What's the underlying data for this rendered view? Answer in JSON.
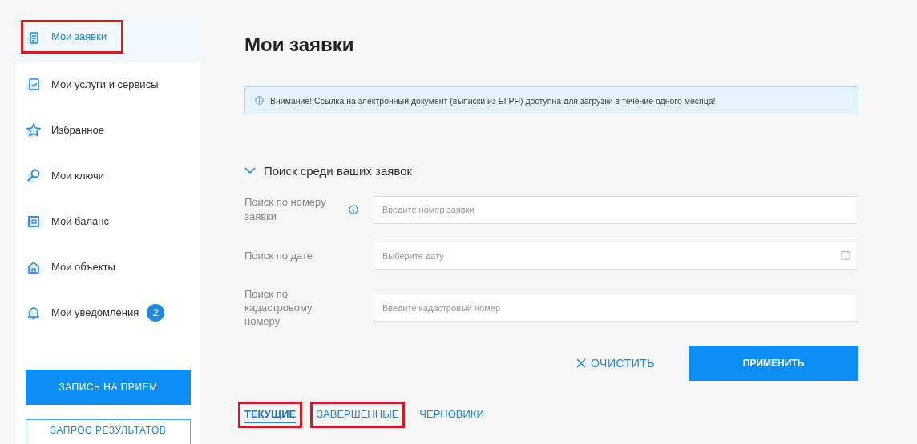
{
  "sidebar": {
    "items": [
      {
        "label": "Мои заявки",
        "kind": "document",
        "selected": true,
        "highlighted": true
      },
      {
        "label": "Мои услуги и сервисы",
        "kind": "checklist",
        "selected": false,
        "highlighted": false
      },
      {
        "label": "Избранное",
        "kind": "star",
        "selected": false,
        "highlighted": false
      },
      {
        "label": "Мои ключи",
        "kind": "key",
        "selected": false,
        "highlighted": false
      },
      {
        "label": "Мой баланс",
        "kind": "wallet",
        "selected": false,
        "highlighted": false
      },
      {
        "label": "Мои объекты",
        "kind": "house",
        "selected": false,
        "highlighted": false
      },
      {
        "label": "Мои уведомления",
        "kind": "bell",
        "selected": false,
        "highlighted": false,
        "badge": "2"
      }
    ],
    "buttons": [
      {
        "label": "ЗАПИСЬ НА ПРИЕМ",
        "kind": "primary"
      },
      {
        "label": "ЗАПРОС РЕЗУЛЬТАТОВ",
        "kind": "outline"
      }
    ]
  },
  "page": {
    "title": "Мои заявки",
    "notice": "Внимание! Ссылка на электронный документ (выписки из ЕГРН) доступна для загрузки в течение одного месяца!",
    "search": {
      "title": "Поиск среди ваших заявок",
      "expanded": true,
      "fields": [
        {
          "label": "Поиск по номеру заявки",
          "placeholder": "Введите номер заявки",
          "kind": "info"
        },
        {
          "label": "Поиск по дате",
          "placeholder": "Выберите дату",
          "kind": "date"
        },
        {
          "label": "Поиск по кадастровому номеру",
          "placeholder": "Введите кадастровый номер",
          "kind": "text"
        }
      ],
      "clear_button": "ОЧИСТИТЬ",
      "apply_button": "ПРИМЕНИТЬ"
    },
    "tabs": [
      {
        "label": "ТЕКУЩИЕ",
        "selected": true,
        "highlighted": true
      },
      {
        "label": "ЗАВЕРШЕННЫЕ",
        "selected": false,
        "highlighted": true
      },
      {
        "label": "ЧЕРНОВИКИ",
        "selected": false,
        "highlighted": false
      }
    ]
  }
}
